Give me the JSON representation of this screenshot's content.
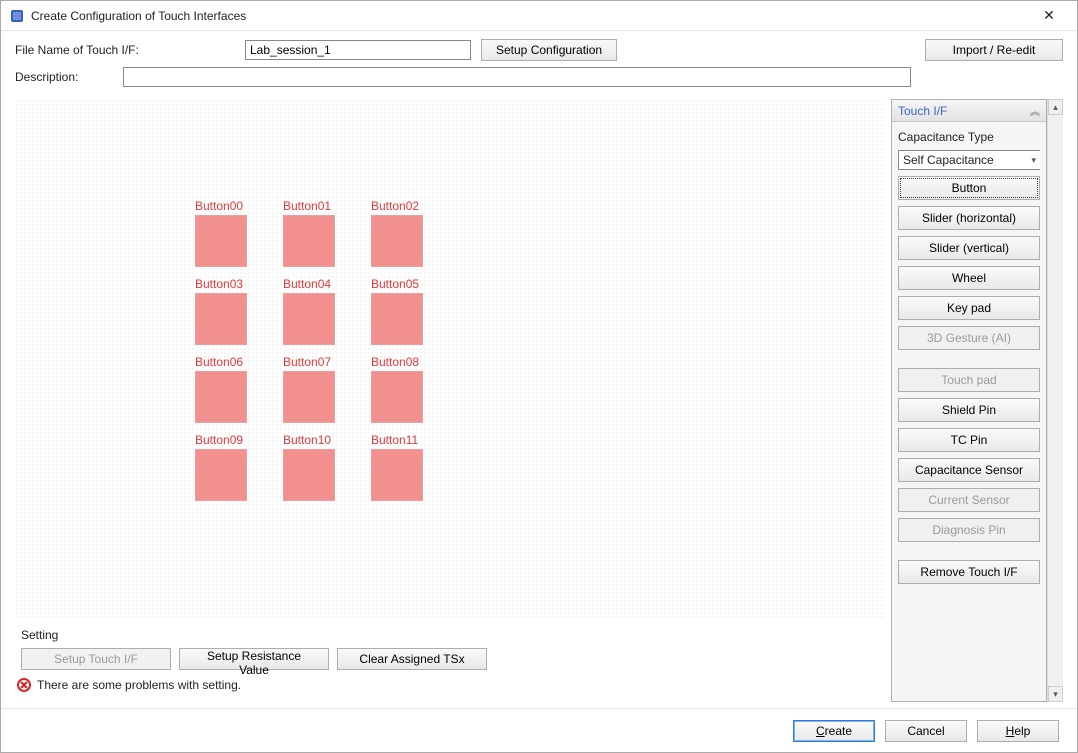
{
  "window": {
    "title": "Create Configuration of Touch Interfaces"
  },
  "form": {
    "filename_label": "File Name of Touch I/F:",
    "filename_value": "Lab_session_1",
    "setup_config_btn": "Setup Configuration",
    "import_btn": "Import / Re-edit",
    "description_label": "Description:",
    "description_value": ""
  },
  "canvas": {
    "pads": [
      {
        "label": "Button00"
      },
      {
        "label": "Button01"
      },
      {
        "label": "Button02"
      },
      {
        "label": "Button03"
      },
      {
        "label": "Button04"
      },
      {
        "label": "Button05"
      },
      {
        "label": "Button06"
      },
      {
        "label": "Button07"
      },
      {
        "label": "Button08"
      },
      {
        "label": "Button09"
      },
      {
        "label": "Button10"
      },
      {
        "label": "Button11"
      }
    ]
  },
  "setting": {
    "title": "Setting",
    "setup_touch_if": "Setup Touch I/F",
    "setup_resistance": "Setup Resistance Value",
    "clear_tsx": "Clear Assigned TSx"
  },
  "status": {
    "message": "There are some problems with setting."
  },
  "panel": {
    "head": "Touch I/F",
    "cap_type_label": "Capacitance Type",
    "cap_type_value": "Self Capacitance",
    "buttons": [
      {
        "label": "Button",
        "selected": true,
        "disabled": false
      },
      {
        "label": "Slider (horizontal)",
        "selected": false,
        "disabled": false
      },
      {
        "label": "Slider (vertical)",
        "selected": false,
        "disabled": false
      },
      {
        "label": "Wheel",
        "selected": false,
        "disabled": false
      },
      {
        "label": "Key pad",
        "selected": false,
        "disabled": false
      },
      {
        "label": "3D Gesture (AI)",
        "selected": false,
        "disabled": true
      }
    ],
    "buttons2": [
      {
        "label": "Touch pad",
        "disabled": true
      },
      {
        "label": "Shield Pin",
        "disabled": false
      },
      {
        "label": "TC Pin",
        "disabled": false
      },
      {
        "label": "Capacitance Sensor",
        "disabled": false
      },
      {
        "label": "Current Sensor",
        "disabled": true
      },
      {
        "label": "Diagnosis Pin",
        "disabled": true
      }
    ],
    "remove_btn": "Remove Touch I/F"
  },
  "footer": {
    "create": "Create",
    "cancel": "Cancel",
    "help": "Help"
  }
}
